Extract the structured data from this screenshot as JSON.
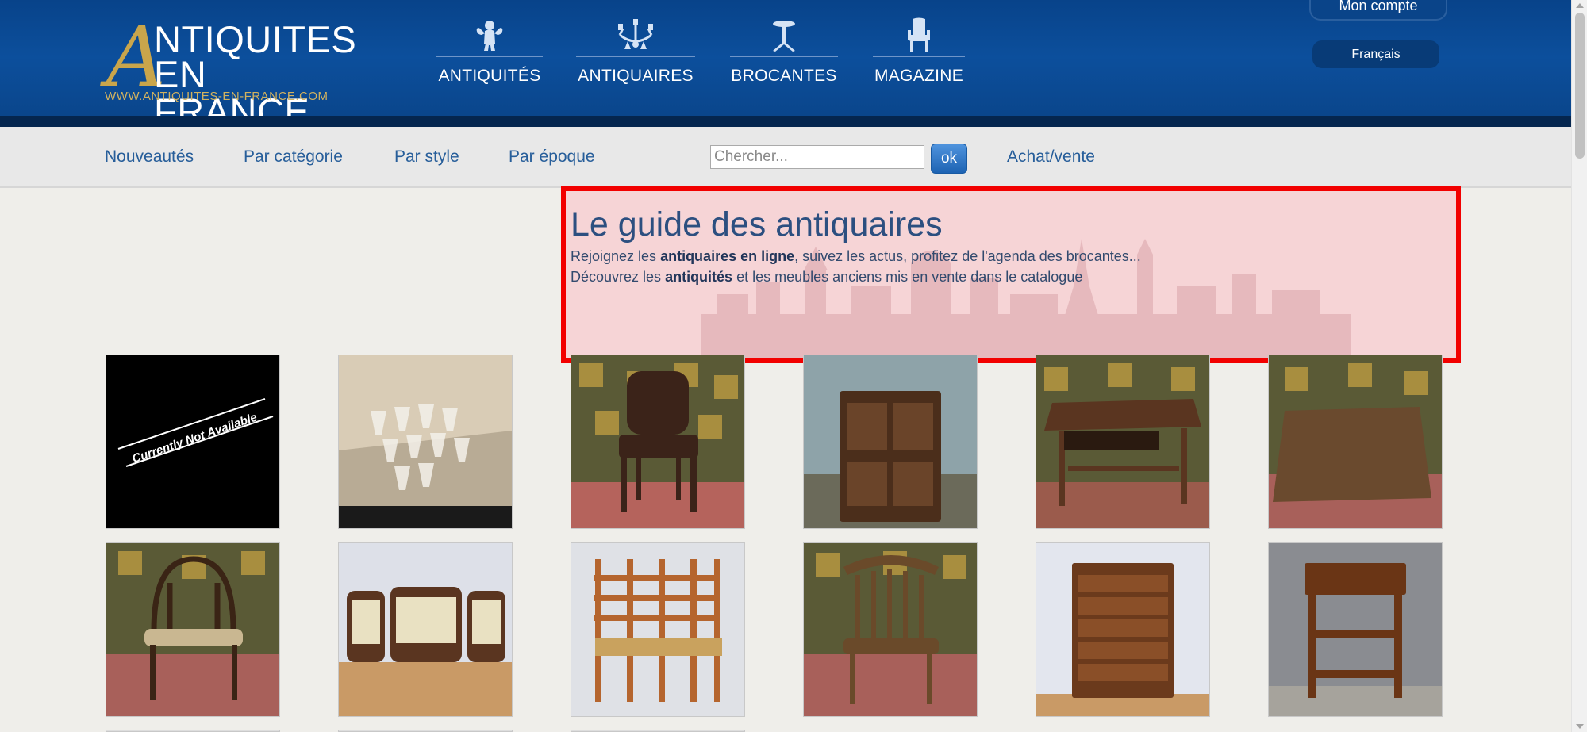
{
  "site": {
    "logo_line1": "NTIQUITES",
    "logo_line2": "EN FRANCE",
    "logo_initial": "A",
    "logo_url": "WWW.ANTIQUITES-EN-FRANCE.COM"
  },
  "nav": [
    {
      "label": "ANTIQUITÉS",
      "icon": "cherub-icon"
    },
    {
      "label": "ANTIQUAIRES",
      "icon": "chandelier-icon"
    },
    {
      "label": "BROCANTES",
      "icon": "pedestal-table-icon"
    },
    {
      "label": "MAGAZINE",
      "icon": "armchair-icon"
    }
  ],
  "account": {
    "label": "Mon compte"
  },
  "language": {
    "label": "Français"
  },
  "subnav": {
    "links": [
      "Nouveautés",
      "Par catégorie",
      "Par style",
      "Par époque"
    ],
    "search_placeholder": "Chercher...",
    "ok_label": "ok",
    "achat_label": "Achat/vente"
  },
  "hero": {
    "title": "Le guide des antiquaires",
    "line1_pre": "Rejoignez les ",
    "line1_bold": "antiquaires en ligne",
    "line1_post": ", suivez les actus, profitez de l'agenda des brocantes...",
    "line2_pre": "Découvrez les ",
    "line2_bold": "antiquités",
    "line2_post": " et les meubles anciens mis en vente dans le catalogue"
  },
  "products": [
    {
      "name": "unavailable",
      "caption": "Currently Not Available"
    },
    {
      "name": "crystal-glasses"
    },
    {
      "name": "cane-chair"
    },
    {
      "name": "wooden-cabinet"
    },
    {
      "name": "writing-table-drawer"
    },
    {
      "name": "square-table"
    },
    {
      "name": "bentwood-chair"
    },
    {
      "name": "sofa-armchairs-set"
    },
    {
      "name": "rush-chairs-set"
    },
    {
      "name": "windsor-chair"
    },
    {
      "name": "chest-of-drawers"
    },
    {
      "name": "side-table"
    }
  ],
  "colors": {
    "header_blue": "#0c4f9c",
    "logo_gold": "#c9a54b",
    "link_blue": "#275e9a",
    "highlight_red": "#f20000"
  }
}
